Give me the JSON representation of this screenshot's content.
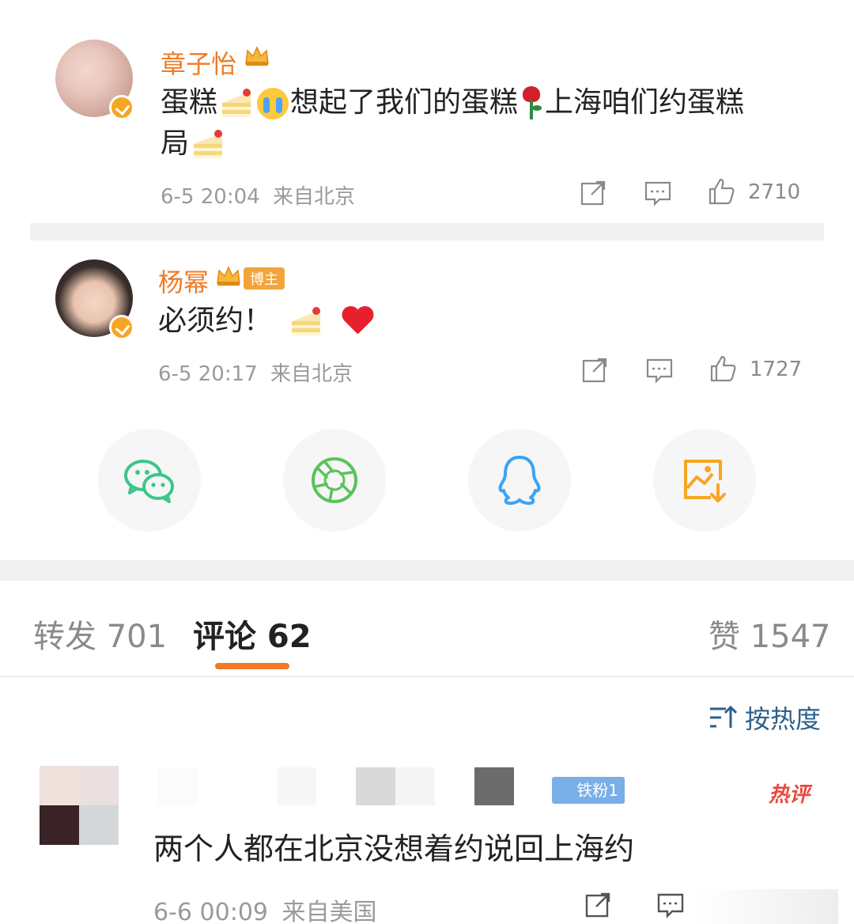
{
  "posts": [
    {
      "name": "章子怡",
      "text_parts": [
        "蛋糕",
        "想起了我们的蛋糕",
        "上海咱们约蛋糕",
        "局"
      ],
      "time": "6-5 20:04",
      "source": "来自北京",
      "likes": "2710"
    },
    {
      "name": "杨幂",
      "badge": "博主",
      "text_parts": [
        "必须约！"
      ],
      "time": "6-5 20:17",
      "source": "来自北京",
      "likes": "1727"
    }
  ],
  "tabs": {
    "repost": "转发 701",
    "comment": "评论 62",
    "like": "赞 1547"
  },
  "sort_label": "按热度",
  "comment": {
    "fan_badge": "铁粉1",
    "hot_tag": "热评",
    "text": "两个人都在北京没想着约说回上海约",
    "time": "6-6 00:09",
    "source": "来自美国"
  },
  "colors": {
    "name": "#f07a25",
    "accent": "#f07a25",
    "wechat": "#3cc68a",
    "moments": "#5bc25a",
    "qq": "#3aa3f5",
    "save": "#f5a623"
  },
  "icons": [
    "share-icon",
    "comment-icon",
    "like-icon",
    "wechat-icon",
    "moments-icon",
    "qq-icon",
    "save-image-icon",
    "sort-icon"
  ]
}
